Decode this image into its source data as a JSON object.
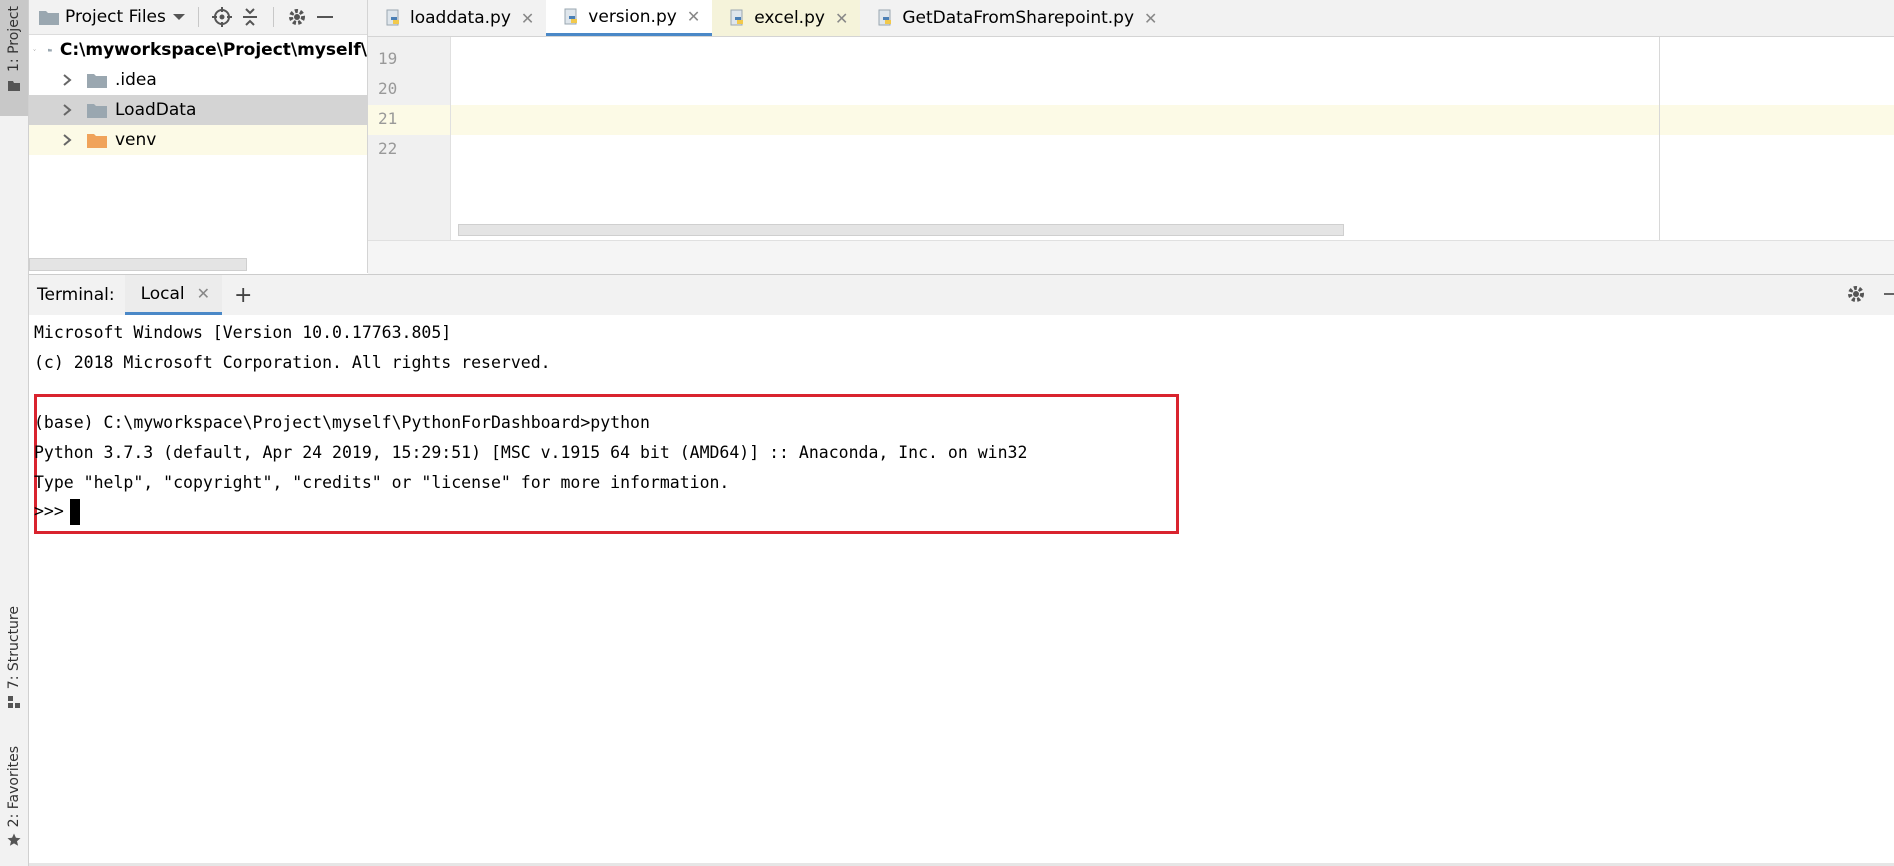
{
  "left_strip": {
    "project_tab": "1: Project",
    "structure_tab": "7: Structure",
    "favorites_tab": "2: Favorites"
  },
  "project_pane": {
    "header_title": "Project Files",
    "tree": [
      {
        "label": "C:\\myworkspace\\Project\\myself\\",
        "bold": true
      },
      {
        "label": ".idea"
      },
      {
        "label": "LoadData"
      },
      {
        "label": "venv"
      }
    ]
  },
  "editor": {
    "tabs": [
      {
        "label": "loaddata.py"
      },
      {
        "label": "version.py"
      },
      {
        "label": "excel.py"
      },
      {
        "label": "GetDataFromSharepoint.py"
      }
    ],
    "line_numbers": [
      "19",
      "20",
      "21",
      "22"
    ]
  },
  "terminal": {
    "label": "Terminal:",
    "tab": "Local",
    "lines": [
      "Microsoft Windows [Version 10.0.17763.805]",
      "(c) 2018 Microsoft Corporation. All rights reserved.",
      "(base) C:\\myworkspace\\Project\\myself\\PythonForDashboard>python",
      "Python 3.7.3 (default, Apr 24 2019, 15:29:51) [MSC v.1915 64 bit (AMD64)] :: Anaconda, Inc. on win32",
      "Type \"help\", \"copyright\", \"credits\" or \"license\" for more information.",
      ">>>"
    ]
  },
  "colors": {
    "accent_tab": "#4a88c7",
    "highlight_box": "#d9232e",
    "current_line": "#fcfae6",
    "venv_folder": "#f0a35a"
  },
  "icons": {
    "header": [
      "folder-icon",
      "dropdown-icon",
      "locate-icon",
      "collapse-icon",
      "gear-icon",
      "minimize-icon"
    ],
    "terminal": [
      "close-icon",
      "add-icon",
      "gear-icon",
      "minimize-icon"
    ]
  }
}
